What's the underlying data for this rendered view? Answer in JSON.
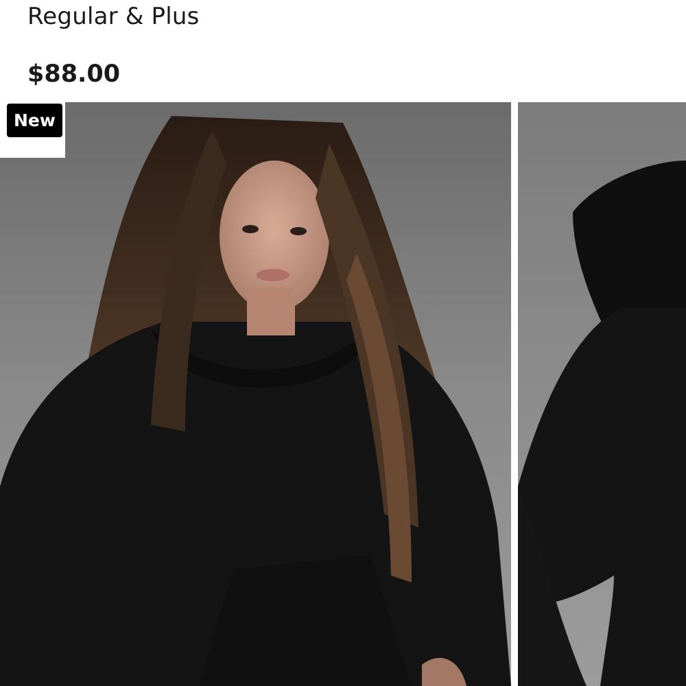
{
  "product": {
    "subtitle": "Regular & Plus",
    "price": "$88.00"
  },
  "gallery": {
    "badge": "New",
    "images": [
      {
        "icon": "model-front-photo",
        "description_name": "woman-in-black-hoodie"
      },
      {
        "icon": "model-side-photo",
        "description_name": "black-hoodie-side"
      }
    ],
    "colors": {
      "backdrop_light": "#8e8e8e",
      "backdrop_dark": "#5c5c5c",
      "garment": "#141414",
      "hair": "#3a2a1f",
      "skin": "#c99a86"
    }
  }
}
